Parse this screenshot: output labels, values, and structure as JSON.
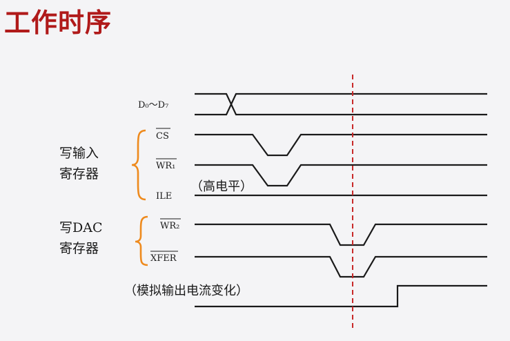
{
  "header": {
    "title": "工作时序"
  },
  "signals": {
    "data": "D₀～D₇",
    "cs": "CS",
    "wr1": "WR₁",
    "ile": "ILE",
    "wr2": "WR₂",
    "xfer": "XFER"
  },
  "groups": {
    "input_reg_line1": "写输入",
    "input_reg_line2": "寄存器",
    "dac_reg_line1": "写DAC",
    "dac_reg_line2": "寄存器"
  },
  "notes": {
    "ile_level": "（高电平）",
    "analog_output": "（模拟输出电流变化）"
  },
  "colors": {
    "title": "#b01a1a",
    "brace": "#ee8a1d",
    "marker": "#c82828",
    "waveform": "#1a1a1a"
  }
}
